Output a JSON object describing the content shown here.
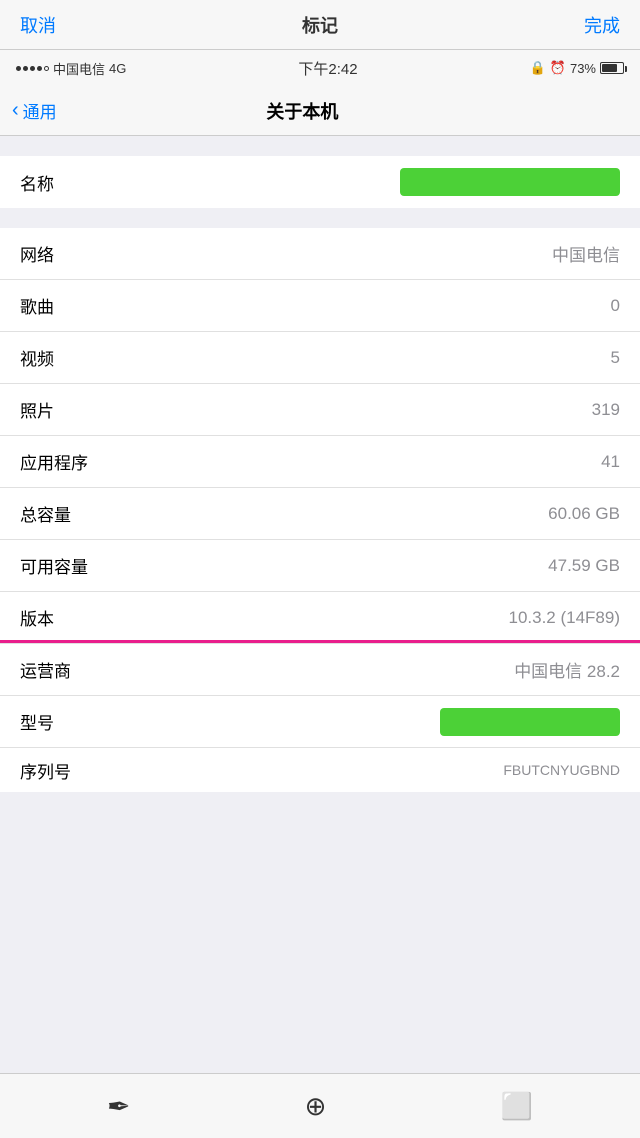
{
  "annotation_bar": {
    "cancel": "取消",
    "title": "标记",
    "done": "完成"
  },
  "status_bar": {
    "carrier": "中国电信",
    "network": "4G",
    "time": "下午2:42",
    "battery_percent": "73%"
  },
  "nav_bar": {
    "back_label": "通用",
    "page_title": "关于本机"
  },
  "rows": [
    {
      "label": "名称",
      "value": "",
      "type": "green-highlight"
    },
    {
      "label": "网络",
      "value": "中国电信",
      "type": "text"
    },
    {
      "label": "歌曲",
      "value": "0",
      "type": "text"
    },
    {
      "label": "视频",
      "value": "5",
      "type": "text"
    },
    {
      "label": "照片",
      "value": "319",
      "type": "text"
    },
    {
      "label": "应用程序",
      "value": "41",
      "type": "text"
    },
    {
      "label": "总容量",
      "value": "60.06 GB",
      "type": "text"
    },
    {
      "label": "可用容量",
      "value": "47.59 GB",
      "type": "text"
    },
    {
      "label": "版本",
      "value": "10.3.2 (14F89)",
      "type": "version"
    },
    {
      "label": "运营商",
      "value": "中国电信 28.2",
      "type": "text"
    },
    {
      "label": "型号",
      "value": "",
      "type": "green-model"
    },
    {
      "label": "序列号",
      "value": "FBUTCNYUGBND",
      "type": "partial"
    }
  ],
  "toolbar": {
    "icon1": "✒",
    "icon2": "⊙",
    "icon3": "⬚"
  }
}
